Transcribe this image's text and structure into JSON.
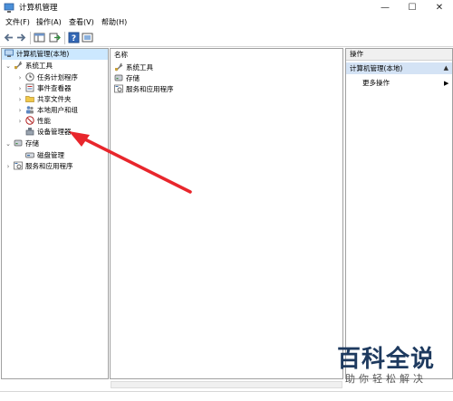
{
  "window": {
    "title": "计算机管理",
    "controls": [
      "—",
      "☐",
      "✕"
    ]
  },
  "menu": [
    "文件(F)",
    "操作(A)",
    "查看(V)",
    "帮助(H)"
  ],
  "tree": {
    "root": "计算机管理(本地)",
    "system_tools": "系统工具",
    "task_scheduler": "任务计划程序",
    "event_viewer": "事件查看器",
    "shared_folders": "共享文件夹",
    "local_users": "本地用户和组",
    "performance": "性能",
    "device_manager": "设备管理器",
    "storage": "存储",
    "disk_management": "磁盘管理",
    "services_apps": "服务和应用程序"
  },
  "center": {
    "header": "名称",
    "items": [
      "系统工具",
      "存储",
      "服务和应用程序"
    ]
  },
  "actions": {
    "header": "操作",
    "selected": "计算机管理(本地)",
    "more": "更多操作"
  },
  "watermark": {
    "big": "百科全说",
    "small": "助你轻松解决"
  },
  "colors": {
    "selection": "#cce8ff",
    "action_selected": "#d4e3f5",
    "arrow": "#e8262c"
  },
  "icons": [
    "computer-icon",
    "tools-icon",
    "clock-icon",
    "event-icon",
    "folder-icon",
    "users-icon",
    "performance-icon",
    "device-icon",
    "storage-icon",
    "disk-icon",
    "services-icon",
    "back-icon",
    "forward-icon",
    "help-icon"
  ]
}
